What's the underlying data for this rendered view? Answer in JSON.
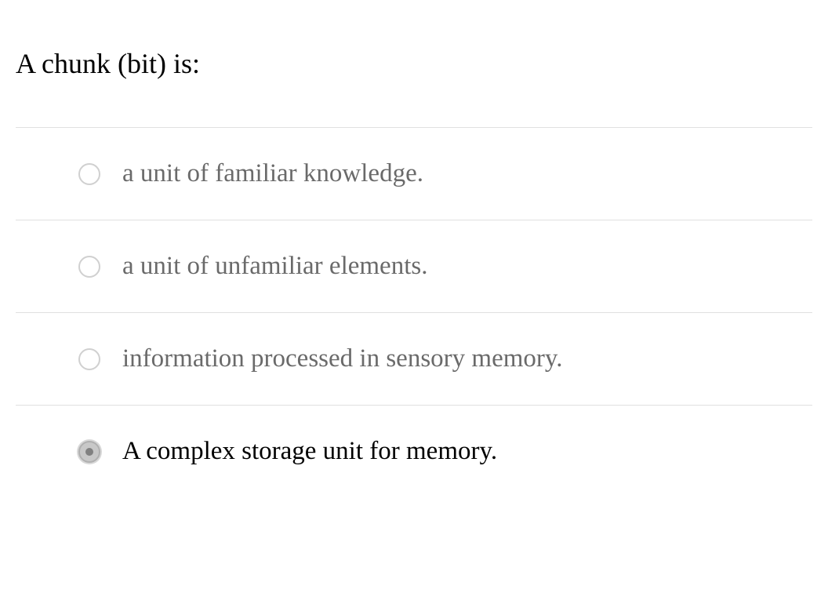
{
  "question": {
    "text": "A chunk (bit) is:"
  },
  "options": [
    {
      "text": "a unit of familiar knowledge.",
      "selected": false
    },
    {
      "text": "a unit of unfamiliar elements.",
      "selected": false
    },
    {
      "text": "information processed in sensory memory.",
      "selected": false
    },
    {
      "text": "A complex storage unit for memory.",
      "selected": true
    }
  ]
}
